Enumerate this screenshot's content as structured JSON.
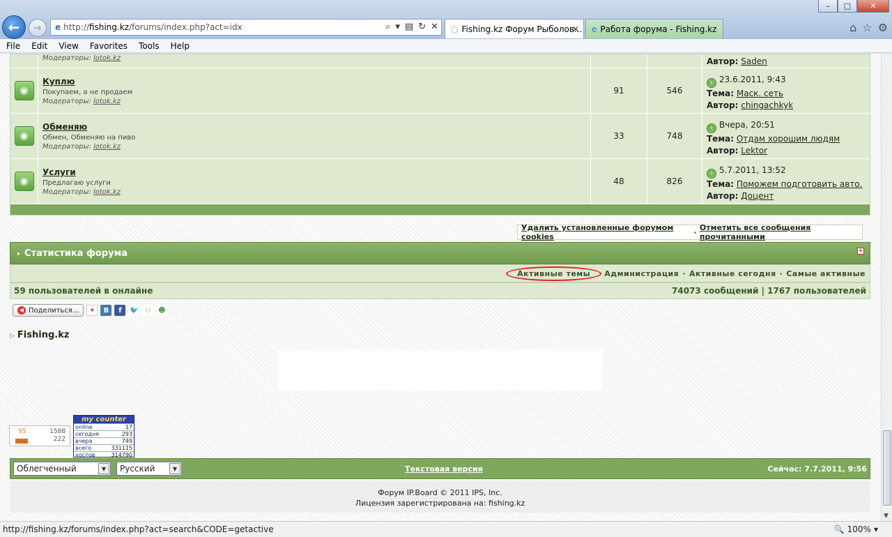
{
  "browser": {
    "address": "http://fishing.kz/forums/index.php?act=idx",
    "address_host": "fishing.kz",
    "address_prefix": "http://",
    "address_path": "/forums/index.php?act=idx",
    "tabs": [
      {
        "label": "Fishing.kz Форум Рыболов..."
      },
      {
        "label": "Работа форума - Fishing.kz"
      }
    ],
    "menu": [
      "File",
      "Edit",
      "View",
      "Favorites",
      "Tools",
      "Help"
    ],
    "status_url": "http://fishing.kz/forums/index.php?act=search&CODE=getactive",
    "zoom": "100%"
  },
  "forums": {
    "partial": {
      "moderators_label": "Модераторы:",
      "moderator": "lotok.kz",
      "last_author_label": "Автор:",
      "last_author": "Saden"
    },
    "rows": [
      {
        "name": "Куплю",
        "desc": "Покупаем, а не продаем",
        "moderators_label": "Модераторы:",
        "moderator": "lotok.kz",
        "topics": "91",
        "posts": "546",
        "last_date": "23.6.2011, 9:43",
        "topic_label": "Тема:",
        "topic": "Маск. сеть",
        "author_label": "Автор:",
        "author": "chingachkyk"
      },
      {
        "name": "Обменяю",
        "desc": "Обмен, Обменяю на пиво",
        "moderators_label": "Модераторы:",
        "moderator": "lotok.kz",
        "topics": "33",
        "posts": "748",
        "last_date": "Вчера, 20:51",
        "topic_label": "Тема:",
        "topic": "Отдам хорошим людям",
        "author_label": "Автор:",
        "author": "Lektor"
      },
      {
        "name": "Услуги",
        "desc": "Предлагаю услуги",
        "moderators_label": "Модераторы:",
        "moderator": "lotok.kz",
        "topics": "48",
        "posts": "826",
        "last_date": "5.7.2011, 13:52",
        "topic_label": "Тема:",
        "topic": "Поможем подготовить авто.",
        "author_label": "Автор:",
        "author": "Доцент"
      }
    ]
  },
  "actions": {
    "delete_cookies": "Удалить установленные форумом cookies",
    "sep": "·",
    "mark_read": "Отметить все сообщения прочитанными"
  },
  "stats": {
    "title": "Статистика форума",
    "links": {
      "active_topics": "Активные темы",
      "admin": "Администрация",
      "active_today": "Активные сегодня",
      "most_active": "Самые активные",
      "dot": "·"
    },
    "online": "59 пользователей в онлайне",
    "totals": "74073 сообщений | 1767 пользователей"
  },
  "share": {
    "label": "Поделиться..."
  },
  "site_title": "Fishing.kz",
  "counter1": {
    "a": "95",
    "b": "1588",
    "c": "222"
  },
  "counter2": {
    "title": "my counter",
    "rows": [
      {
        "label": "online",
        "value": "17"
      },
      {
        "label": "сегодня",
        "value": "293"
      },
      {
        "label": "вчера",
        "value": "749"
      },
      {
        "label": "всего",
        "value": "331115"
      },
      {
        "label": "хостов",
        "value": "314790"
      }
    ]
  },
  "footer": {
    "skin": "Облегченный",
    "language": "Русский",
    "text_version": "Текстовая версия",
    "now": "Сейчас: 7.7.2011, 9:56",
    "copyright1": "Форум IP.Board © 2011  IPS, Inc.",
    "copyright2": "Лицензия зарегистрирована на: fishing.kz"
  }
}
